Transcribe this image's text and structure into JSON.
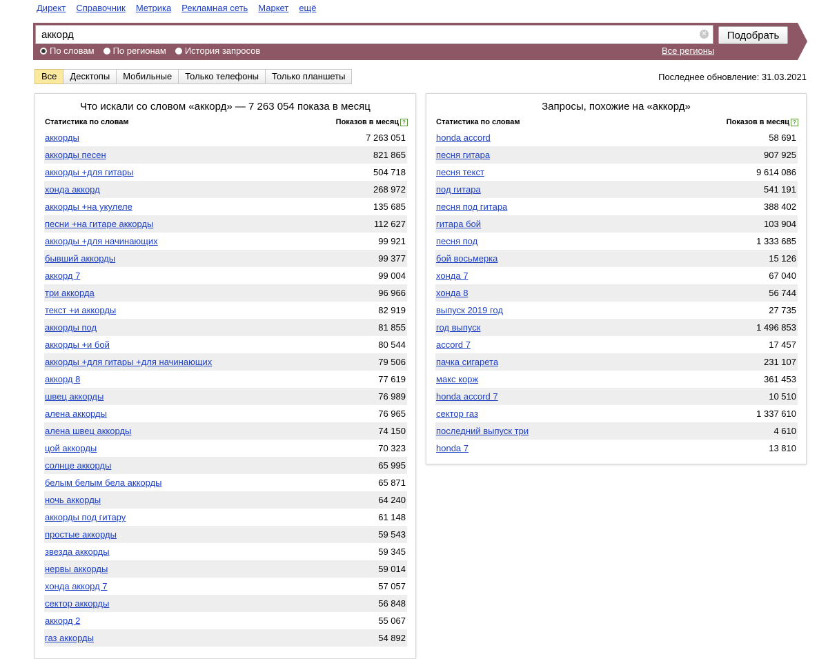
{
  "nav": {
    "items": [
      "Директ",
      "Справочник",
      "Метрика",
      "Рекламная сеть",
      "Маркет",
      "ещё"
    ]
  },
  "search": {
    "value": "аккорд",
    "submit_label": "Подобрать",
    "radios": [
      {
        "label": "По словам",
        "selected": true
      },
      {
        "label": "По регионам",
        "selected": false
      },
      {
        "label": "История запросов",
        "selected": false
      }
    ],
    "regions_label": "Все регионы"
  },
  "tabs": [
    "Все",
    "Десктопы",
    "Мобильные",
    "Только телефоны",
    "Только планшеты"
  ],
  "active_tab": "Все",
  "last_update": "Последнее обновление: 31.03.2021",
  "left": {
    "title": "Что искали со словом «аккорд» — 7 263 054 показа в месяц",
    "col_words": "Статистика по словам",
    "col_shows": "Показов в месяц",
    "rows": [
      {
        "q": "аккорды",
        "v": "7 263 051"
      },
      {
        "q": "аккорды песен",
        "v": "821 865"
      },
      {
        "q": "аккорды +для гитары",
        "v": "504 718"
      },
      {
        "q": "хонда аккорд",
        "v": "268 972"
      },
      {
        "q": "аккорды +на укулеле",
        "v": "135 685"
      },
      {
        "q": "песни +на гитаре аккорды",
        "v": "112 627"
      },
      {
        "q": "аккорды +для начинающих",
        "v": "99 921"
      },
      {
        "q": "бывший аккорды",
        "v": "99 377"
      },
      {
        "q": "аккорд 7",
        "v": "99 004"
      },
      {
        "q": "три аккорда",
        "v": "96 966"
      },
      {
        "q": "текст +и аккорды",
        "v": "82 919"
      },
      {
        "q": "аккорды под",
        "v": "81 855"
      },
      {
        "q": "аккорды +и бой",
        "v": "80 544"
      },
      {
        "q": "аккорды +для гитары +для начинающих",
        "v": "79 506"
      },
      {
        "q": "аккорд 8",
        "v": "77 619"
      },
      {
        "q": "швец аккорды",
        "v": "76 989"
      },
      {
        "q": "алена аккорды",
        "v": "76 965"
      },
      {
        "q": "алена швец аккорды",
        "v": "74 150"
      },
      {
        "q": "цой аккорды",
        "v": "70 323"
      },
      {
        "q": "солнце аккорды",
        "v": "65 995"
      },
      {
        "q": "белым белым бела аккорды",
        "v": "65 871"
      },
      {
        "q": "ночь аккорды",
        "v": "64 240"
      },
      {
        "q": "аккорды под гитару",
        "v": "61 148"
      },
      {
        "q": "простые аккорды",
        "v": "59 543"
      },
      {
        "q": "звезда аккорды",
        "v": "59 345"
      },
      {
        "q": "нервы аккорды",
        "v": "59 014"
      },
      {
        "q": "хонда аккорд 7",
        "v": "57 057"
      },
      {
        "q": "сектор аккорды",
        "v": "56 848"
      },
      {
        "q": "аккорд 2",
        "v": "55 067"
      },
      {
        "q": "газ аккорды",
        "v": "54 892"
      }
    ]
  },
  "right": {
    "title": "Запросы, похожие на «аккорд»",
    "col_words": "Статистика по словам",
    "col_shows": "Показов в месяц",
    "rows": [
      {
        "q": "honda accord",
        "v": "58 691"
      },
      {
        "q": "песня гитара",
        "v": "907 925"
      },
      {
        "q": "песня текст",
        "v": "9 614 086"
      },
      {
        "q": "под гитара",
        "v": "541 191"
      },
      {
        "q": "песня под гитара",
        "v": "388 402"
      },
      {
        "q": "гитара бой",
        "v": "103 904"
      },
      {
        "q": "песня под",
        "v": "1 333 685"
      },
      {
        "q": "бой восьмерка",
        "v": "15 126"
      },
      {
        "q": "хонда 7",
        "v": "67 040"
      },
      {
        "q": "хонда 8",
        "v": "56 744"
      },
      {
        "q": "выпуск 2019 год",
        "v": "27 735"
      },
      {
        "q": "год выпуск",
        "v": "1 496 853"
      },
      {
        "q": "accord 7",
        "v": "17 457"
      },
      {
        "q": "пачка сигарета",
        "v": "231 107"
      },
      {
        "q": "макс корж",
        "v": "361 453"
      },
      {
        "q": "honda accord 7",
        "v": "10 510"
      },
      {
        "q": "сектор газ",
        "v": "1 337 610"
      },
      {
        "q": "последний выпуск три",
        "v": "4 610"
      },
      {
        "q": "honda 7",
        "v": "13 810"
      }
    ]
  },
  "colors": {
    "band": "#8d5765",
    "link": "#1a3dc1",
    "active_tab": "#fbe9a0"
  }
}
